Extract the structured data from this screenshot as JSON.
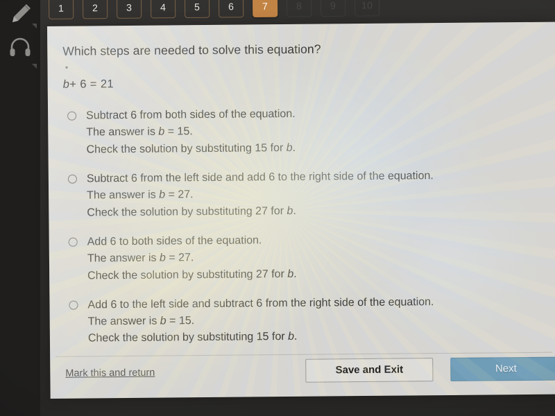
{
  "rail": {
    "icons": [
      {
        "name": "pencil-icon",
        "label": "Draw"
      },
      {
        "name": "headphones-icon",
        "label": "Listen"
      }
    ]
  },
  "tabs": {
    "items": [
      {
        "label": "1",
        "state": "available"
      },
      {
        "label": "2",
        "state": "available"
      },
      {
        "label": "3",
        "state": "available"
      },
      {
        "label": "4",
        "state": "available"
      },
      {
        "label": "5",
        "state": "available"
      },
      {
        "label": "6",
        "state": "available"
      },
      {
        "label": "7",
        "state": "active"
      },
      {
        "label": "8",
        "state": "disabled"
      },
      {
        "label": "9",
        "state": "disabled"
      },
      {
        "label": "10",
        "state": "disabled"
      }
    ],
    "active_index": 6,
    "active_color": "#c28445"
  },
  "question": {
    "prompt": "Which steps are needed to solve this equation?",
    "equation_variable": "b",
    "equation_rest": "+ 6 = 21",
    "equation_full": "b + 6 = 21"
  },
  "options": [
    {
      "line1": "Subtract 6 from both sides of the equation.",
      "line2_prefix": "The answer is ",
      "line2_var": "b",
      "line2_suffix": " = 15.",
      "line3": "Check the solution by substituting 15 for ",
      "line3_var": "b",
      "line3_end": ".",
      "selected": false
    },
    {
      "line1": "Subtract 6 from the left side and add 6 to the right side of the equation.",
      "line2_prefix": "The answer is ",
      "line2_var": "b",
      "line2_suffix": " = 27.",
      "line3": "Check the solution by substituting 27 for ",
      "line3_var": "b",
      "line3_end": ".",
      "selected": false
    },
    {
      "line1": "Add 6 to both sides of the equation.",
      "line2_prefix": "The answer is ",
      "line2_var": "b",
      "line2_suffix": " = 27.",
      "line3": "Check the solution by substituting 27 for ",
      "line3_var": "b",
      "line3_end": ".",
      "selected": false
    },
    {
      "line1": "Add 6 to the left side and subtract 6 from the right side of the equation.",
      "line2_prefix": "The answer is ",
      "line2_var": "b",
      "line2_suffix": " = 15.",
      "line3": "Check the solution by substituting 15 for ",
      "line3_var": "b",
      "line3_end": ".",
      "selected": false
    }
  ],
  "footer": {
    "mark_link": "Mark this and return",
    "save_exit_label": "Save and Exit",
    "next_label": "Next",
    "next_color": "#6f9cb6"
  }
}
